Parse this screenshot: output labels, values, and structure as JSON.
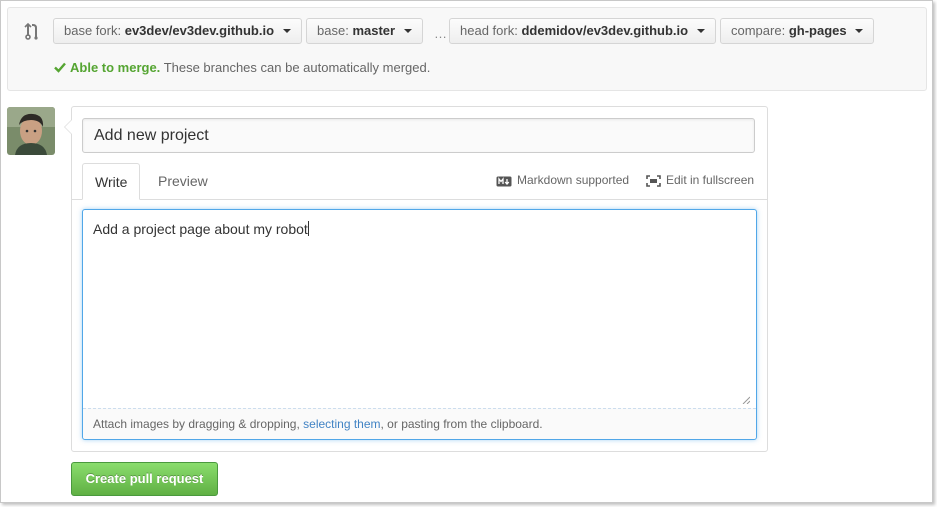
{
  "compare": {
    "base_fork": {
      "label": "base fork:",
      "value": "ev3dev/ev3dev.github.io"
    },
    "base": {
      "label": "base:",
      "value": "master"
    },
    "separator": "…",
    "head_fork": {
      "label": "head fork:",
      "value": "ddemidov/ev3dev.github.io"
    },
    "compare_branch": {
      "label": "compare:",
      "value": "gh-pages"
    },
    "merge_status": "Able to merge.",
    "merge_message": "These branches can be automatically merged."
  },
  "form": {
    "title_value": "Add new project",
    "tabs": [
      "Write",
      "Preview"
    ],
    "markdown_label": "Markdown supported",
    "fullscreen_label": "Edit in fullscreen",
    "body_value": "Add a project page about my robot",
    "attach_prefix": "Attach images by dragging & dropping, ",
    "attach_link": "selecting them",
    "attach_suffix": ", or pasting from the clipboard."
  },
  "submit_label": "Create pull request",
  "colors": {
    "success": "#55a532",
    "link": "#4183c4",
    "button": "#60b044",
    "focus": "#51a7e8"
  },
  "icons": [
    "compare-icon",
    "check-icon",
    "caret-down-icon",
    "markdown-icon",
    "fullscreen-icon",
    "resize-handle-icon"
  ]
}
